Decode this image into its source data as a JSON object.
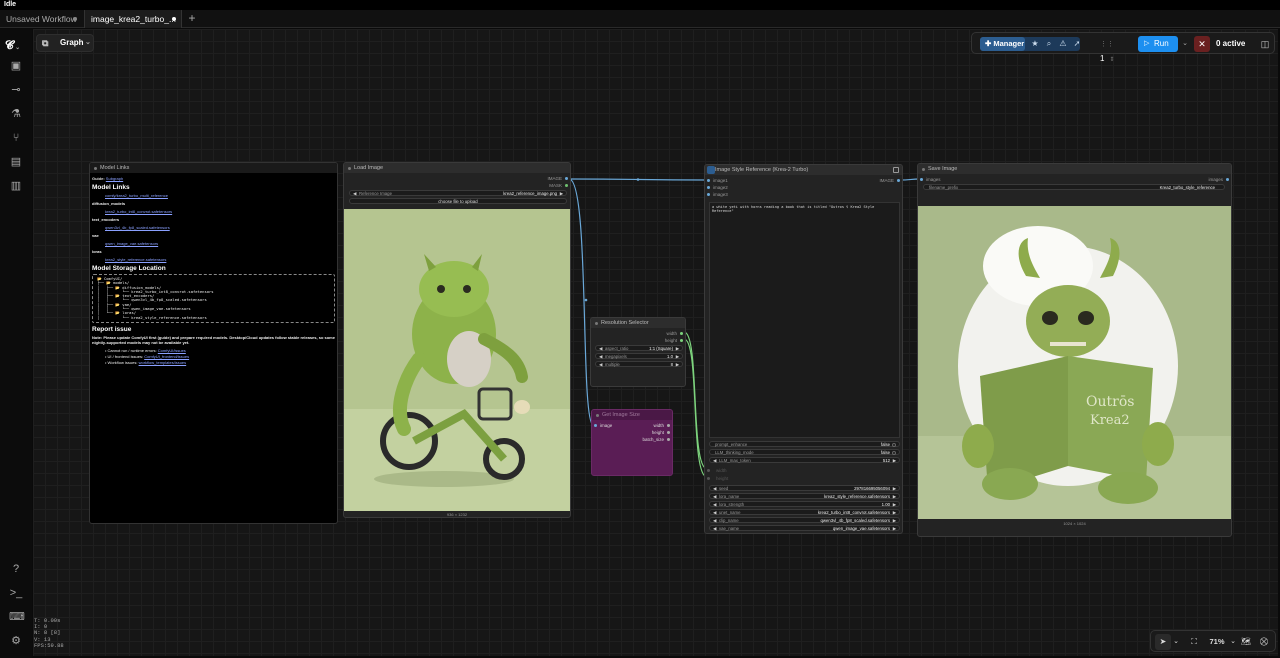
{
  "app": {
    "title": "Idle"
  },
  "tabs": [
    {
      "label": "Unsaved Workflow"
    },
    {
      "label": "image_krea2_turbo_..."
    }
  ],
  "toolbar": {
    "graph_label": "Graph",
    "manager_label": "Manager",
    "queue_count": "1",
    "run_label": "Run",
    "active_label": "0 active",
    "zoom_label": "71%"
  },
  "stats": {
    "lines": [
      "T: 0.00s",
      "I: 0",
      "N: 8 [8]",
      "V: 13",
      "FPS:59.88"
    ]
  },
  "nodes": {
    "model_links": {
      "title": "Model Links",
      "guide_prefix": "Guide:",
      "guide_link": "Subgraph",
      "heading1": "Model Links",
      "text_encoder_item": "comfy/krea2_turbo_multi_reference",
      "section_diffusion": "diffusion_models",
      "diffusion_item": "krea2_turbo_int8_convrot.safetensors",
      "section_text_encoders": "text_encoders",
      "te_item": "qwen3vl_4b_fp8_scaled.safetensors",
      "section_vae": "vae",
      "vae_item": "qwen_image_vae.safetensors",
      "section_loras": "loras",
      "lora_item": "krea2_style_reference.safetensors",
      "heading2": "Model Storage Location",
      "tree": "📂 ComfyUI/\n├── 📂 models/\n│   ├── 📂 diffusion_models/\n│   │      └── krea2_turbo_int8_convrot.safetensors\n│   ├── 📂 text_encoders/\n│   │      └── qwen3vl_4b_fp8_scaled.safetensors\n│   ├── 📂 vae/\n│   │      └── qwen_image_vae.safetensors\n│   └── 📂 loras/\n│          └── krea2_style_reference.safetensors",
      "heading3": "Report issue",
      "note": "Note: Please update ComfyUI first (guide) and prepare required models. Desktop/Cloud updates follow stable releases, so some nightly-supported models may not be available yet.",
      "issue1_label": "Cannot run / runtime errors:",
      "issue1_link": "ComfyUI/issues",
      "issue2_label": "UI / frontend issues:",
      "issue2_link": "ComfyUI_frontend/issues",
      "issue3_label": "Workflow issues:",
      "issue3_link": "workflow_templates/issues"
    },
    "load_image": {
      "title": "Load Image",
      "out_image": "IMAGE",
      "out_mask": "MASK",
      "image_label": "Reference Image",
      "image_value": "krea2_reference_image.png",
      "upload_label": "choose file to upload",
      "size": "936 × 1232"
    },
    "resolution": {
      "title": "Resolution Selector",
      "out_width": "width",
      "out_height": "height",
      "aspect_label": "aspect_ratio",
      "aspect_value": "1:1 (Square)",
      "mp_label": "megapixels",
      "mp_value": "1.0",
      "mult_label": "multiple",
      "mult_value": "8"
    },
    "image_size": {
      "title": "Get Image Size",
      "in_image": "image",
      "out_width": "width",
      "out_height": "height",
      "out_batch": "batch_size"
    },
    "style_ref": {
      "title": "Image Style Reference (Krea-2 Turbo)",
      "in1": "image1",
      "in2": "image2",
      "in3": "image3",
      "out_image": "IMAGE",
      "prompt": "a white yeti with horns reading a book that is titled \"Outros ♀ Krea2 Style Reference\"",
      "widgets": [
        {
          "label": "prompt_enhance",
          "value": "false"
        },
        {
          "label": "LLM_thinking_mode",
          "value": "false"
        },
        {
          "label": "LLM_max_token",
          "value": "512"
        }
      ],
      "in_width": "width",
      "in_height": "height",
      "widgets2": [
        {
          "label": "seed",
          "value": "297816695056094"
        },
        {
          "label": "lora_name",
          "value": "krea2_style_reference.safetensors"
        },
        {
          "label": "lora_strength",
          "value": "1.00"
        },
        {
          "label": "unet_name",
          "value": "krea2_turbo_int8_convrot.safetensors"
        },
        {
          "label": "clip_name",
          "value": "qwen3vl_4b_fp8_scaled.safetensors"
        },
        {
          "label": "vae_name",
          "value": "qwen_image_vae.safetensors"
        }
      ]
    },
    "save_image": {
      "title": "Save Image",
      "in_images": "images",
      "out_images": "images",
      "prefix_label": "filename_prefix",
      "prefix_value": "Krea2_turbo_style_reference",
      "size": "1024 × 1024"
    }
  },
  "colors": {
    "accent": "#1d8ff0",
    "link_blue": "#6aa8d8",
    "link_green": "#7dd37d",
    "get_size_node": "#5a1d55",
    "manager_bg": "#2c5d90",
    "image_bg_green": "#b5c590"
  }
}
